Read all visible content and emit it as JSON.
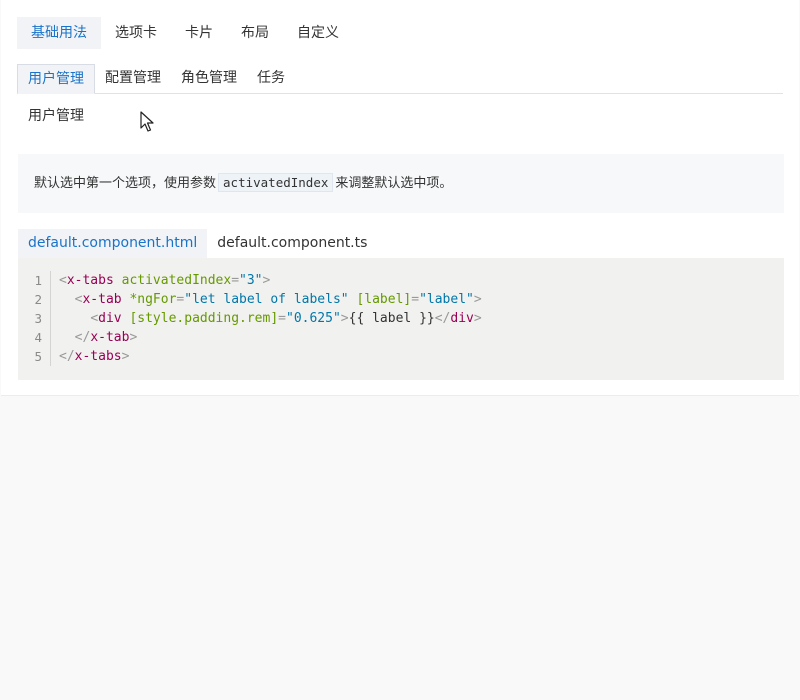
{
  "top_tabs": [
    {
      "label": "基础用法",
      "active": true
    },
    {
      "label": "选项卡",
      "active": false
    },
    {
      "label": "卡片",
      "active": false
    },
    {
      "label": "布局",
      "active": false
    },
    {
      "label": "自定义",
      "active": false
    }
  ],
  "demo": {
    "tabs": [
      {
        "label": "用户管理",
        "active": true
      },
      {
        "label": "配置管理",
        "active": false
      },
      {
        "label": "角色管理",
        "active": false
      },
      {
        "label": "任务",
        "active": false
      }
    ],
    "content": "用户管理"
  },
  "description": {
    "before": "默认选中第一个选项，使用参数",
    "code": "activatedIndex",
    "after": "来调整默认选中项。"
  },
  "file_tabs": [
    {
      "label": "default.component.html",
      "active": true
    },
    {
      "label": "default.component.ts",
      "active": false
    }
  ],
  "code": {
    "line_numbers": [
      "1",
      "2",
      "3",
      "4",
      "5"
    ],
    "l1": {
      "open": "<",
      "tag": "x-tabs",
      "attr": "activatedIndex",
      "eq": "=",
      "val": "\"3\"",
      "close": ">"
    },
    "l2": {
      "indent": "  ",
      "open": "<",
      "tag": "x-tab",
      "attr1": "*ngFor",
      "eq1": "=",
      "val1": "\"let label of labels\"",
      "attr2": "[label]",
      "eq2": "=",
      "val2": "\"label\"",
      "close": ">"
    },
    "l3": {
      "indent": "    ",
      "open": "<",
      "tag": "div",
      "attr": "[style.padding.rem]",
      "eq": "=",
      "val": "\"0.625\"",
      "close": ">",
      "text": "{{ label }}",
      "end_open": "</",
      "end_tag": "div",
      "end_close": ">"
    },
    "l4": {
      "indent": "  ",
      "open": "</",
      "tag": "x-tab",
      "close": ">"
    },
    "l5": {
      "open": "</",
      "tag": "x-tabs",
      "close": ">"
    }
  },
  "colors": {
    "accent": "#1a73c8",
    "tag": "#990055",
    "attr": "#669900",
    "string": "#0077aa"
  }
}
